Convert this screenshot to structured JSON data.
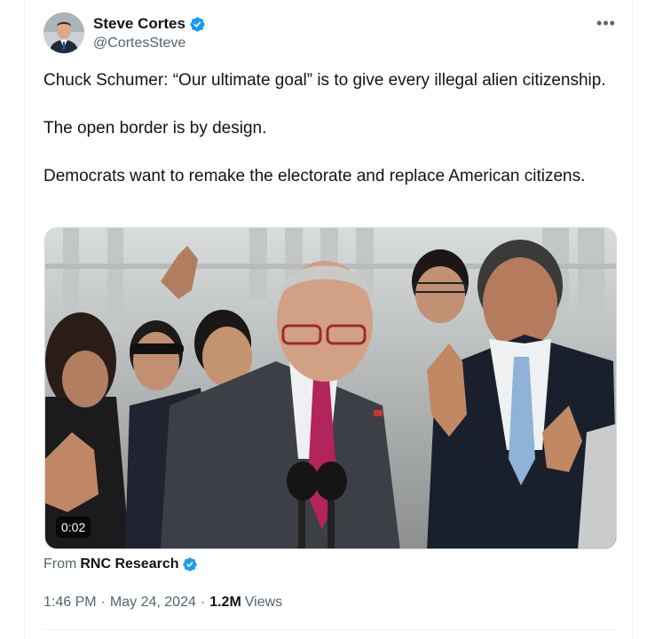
{
  "author": {
    "display_name": "Steve Cortes",
    "handle": "@CortesSteve",
    "verified_icon": "verified-badge-icon"
  },
  "more_label": "•••",
  "tweet_text": {
    "paragraph_1": "Chuck Schumer: “Our ultimate goal” is to give every illegal alien citizenship.",
    "paragraph_2": "The open border is by design.",
    "paragraph_3": "Democrats want to remake the electorate and replace American citizens."
  },
  "media": {
    "duration": "0:02"
  },
  "attribution": {
    "from_label": "From",
    "source_name": "RNC Research"
  },
  "meta": {
    "time": "1:46 PM",
    "separator": "·",
    "date": "May 24, 2024",
    "views_count": "1.2M",
    "views_label": "Views"
  },
  "colors": {
    "verified_blue": "#1d9bf0",
    "secondary_text": "#536471",
    "primary_text": "#0f1419"
  }
}
